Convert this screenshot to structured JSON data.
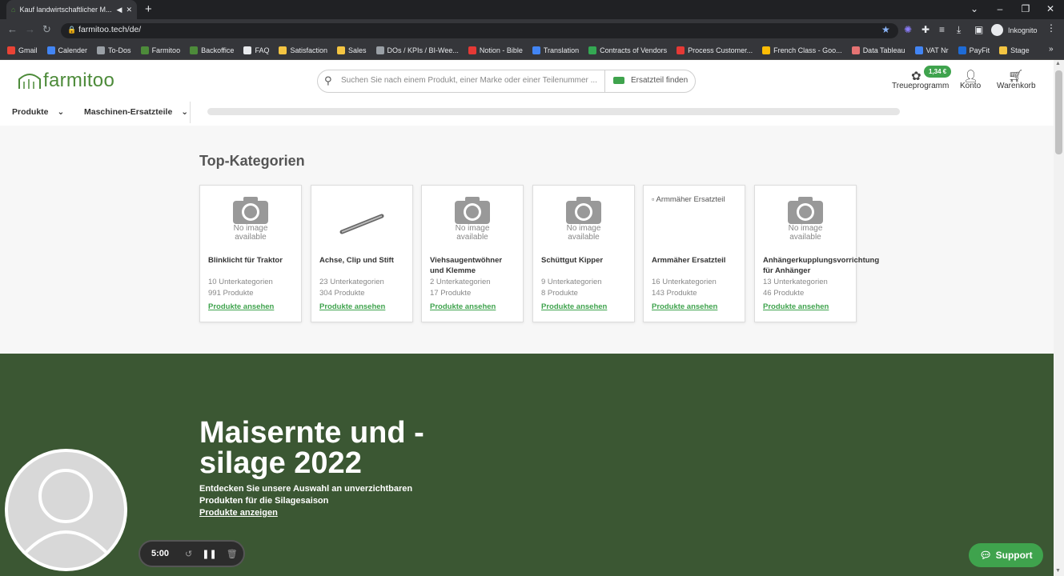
{
  "browser": {
    "tab_title": "Kauf landwirtschaftlicher M...",
    "url": "farmitoo.tech/de/",
    "profile": "Inkognito",
    "bookmarks": [
      {
        "label": "Gmail",
        "color": "#ea4335"
      },
      {
        "label": "Calender",
        "color": "#4285f4"
      },
      {
        "label": "To-Dos",
        "color": "#9aa0a6"
      },
      {
        "label": "Farmitoo",
        "color": "#4d8b3a"
      },
      {
        "label": "Backoffice",
        "color": "#4d8b3a"
      },
      {
        "label": "FAQ",
        "color": "#e8eaed"
      },
      {
        "label": "Satisfaction",
        "color": "#f4c542"
      },
      {
        "label": "Sales",
        "color": "#f4c542"
      },
      {
        "label": "DOs / KPIs / BI-Wee...",
        "color": "#9aa0a6"
      },
      {
        "label": "Notion - Bible",
        "color": "#e53935"
      },
      {
        "label": "Translation",
        "color": "#4285f4"
      },
      {
        "label": "Contracts of Vendors",
        "color": "#34a853"
      },
      {
        "label": "Process Customer...",
        "color": "#e53935"
      },
      {
        "label": "French Class - Goo...",
        "color": "#fbbc05"
      },
      {
        "label": "Data Tableau",
        "color": "#e57373"
      },
      {
        "label": "VAT Nr",
        "color": "#4285f4"
      },
      {
        "label": "PayFit",
        "color": "#1e6bd6"
      },
      {
        "label": "Stage",
        "color": "#f4c542"
      }
    ]
  },
  "header": {
    "logo_text": "farmitoo",
    "search_placeholder": "Suchen Sie nach einem Produkt, einer Marke oder einer Teilenummer ...",
    "spare_part_button": "Ersatzteil finden",
    "loyalty_badge": "1,34 €",
    "loyalty_label": "Treueprogramm",
    "account_label": "Konto",
    "cart_label": "Warenkorb",
    "nav": [
      {
        "label": "Produkte"
      },
      {
        "label": "Maschinen-Ersatzteile"
      }
    ]
  },
  "main": {
    "section_title": "Top-Kategorien",
    "no_image_text": "No image available",
    "cards": [
      {
        "name": "Blinklicht für Traktor",
        "subcats": "10 Unterkategorien",
        "products": "991 Produkte",
        "link": "Produkte ansehen",
        "image": "no-image"
      },
      {
        "name": "Achse, Clip und Stift",
        "subcats": "23 Unterkategorien",
        "products": "304 Produkte",
        "link": "Produkte ansehen",
        "image": "pin"
      },
      {
        "name": "Viehsaugentwöhner und Klemme",
        "subcats": "2 Unterkategorien",
        "products": "17 Produkte",
        "link": "Produkte ansehen",
        "image": "no-image"
      },
      {
        "name": "Schüttgut Kipper",
        "subcats": "9 Unterkategorien",
        "products": "8 Produkte",
        "link": "Produkte ansehen",
        "image": "no-image"
      },
      {
        "name": "Armmäher Ersatzteil",
        "subcats": "16 Unterkategorien",
        "products": "143 Produkte",
        "link": "Produkte ansehen",
        "image": "broken",
        "alt": "Armmäher Ersatzteil"
      },
      {
        "name": "Anhängerkupplungsvorrichtung für Anhänger",
        "subcats": "13 Unterkategorien",
        "products": "46 Produkte",
        "link": "Produkte ansehen",
        "image": "no-image"
      }
    ]
  },
  "banner": {
    "title": "Maisernte und - silage 2022",
    "subtitle": "Entdecken Sie unsere Auswahl an unverzichtbaren Produkten für die Silagesaison",
    "link": "Produkte anzeigen",
    "bg_color": "#3b5733"
  },
  "recorder": {
    "time": "5:00"
  },
  "support": {
    "label": "Support"
  }
}
